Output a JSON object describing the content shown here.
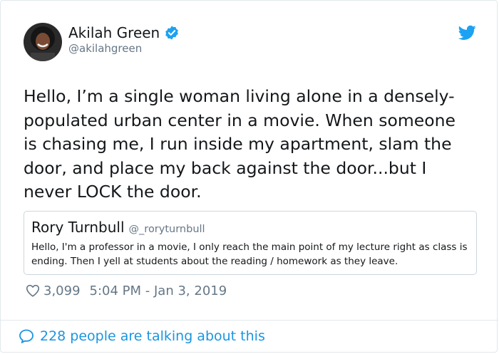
{
  "author": {
    "name": "Akilah Green",
    "handle": "@akilahgreen",
    "verified": true
  },
  "tweet": {
    "text": "Hello, I’m a single woman living alone in a densely-\npopulated urban center in a movie. When someone\nis chasing me, I run inside my apartment, slam the\ndoor, and place my back against the door...but I\nnever LOCK the door."
  },
  "quoted": {
    "name": "Rory Turnbull",
    "handle": "@_roryturnbull",
    "text": "Hello, I'm a professor in a movie, I only reach the main point of my lecture right as class is ending. Then I yell at students about the reading / homework as they leave."
  },
  "meta": {
    "likes": "3,099",
    "timestamp": "5:04 PM - Jan 3, 2019"
  },
  "footer": {
    "talking": "228 people are talking about this"
  },
  "colors": {
    "accent": "#1da1f2",
    "link": "#1b95e0",
    "secondary_text": "#657786",
    "border": "#e1e8ed"
  },
  "icons": [
    "avatar",
    "verified-badge-icon",
    "twitter-bird-icon",
    "heart-icon",
    "speech-bubble-icon"
  ]
}
